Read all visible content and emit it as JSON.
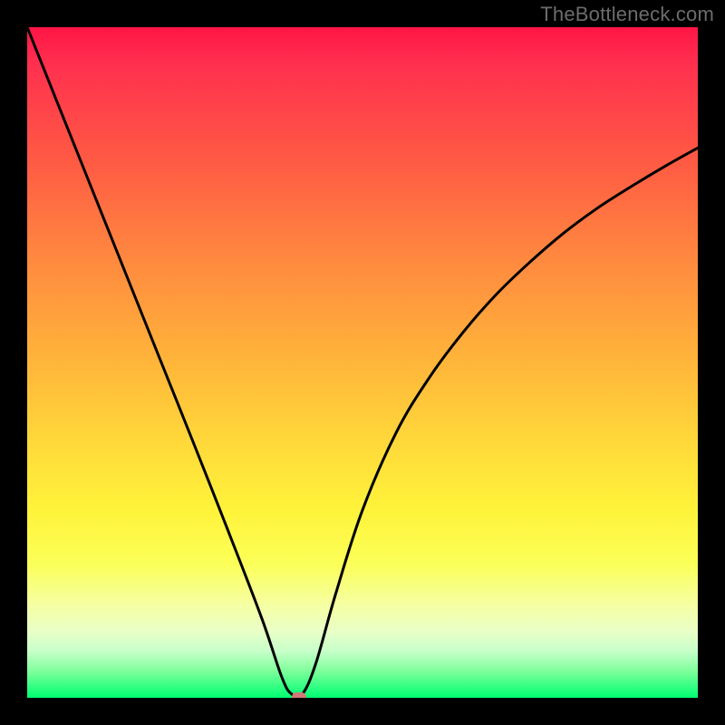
{
  "watermark": "TheBottleneck.com",
  "chart_data": {
    "type": "line",
    "title": "",
    "xlabel": "",
    "ylabel": "",
    "xlim": [
      0,
      1
    ],
    "ylim": [
      0,
      1
    ],
    "series": [
      {
        "name": "curve",
        "x": [
          0.0,
          0.05,
          0.1,
          0.15,
          0.2,
          0.25,
          0.3,
          0.35,
          0.38,
          0.395,
          0.41,
          0.43,
          0.46,
          0.5,
          0.55,
          0.6,
          0.65,
          0.7,
          0.75,
          0.8,
          0.85,
          0.9,
          0.95,
          1.0
        ],
        "y": [
          1.0,
          0.875,
          0.75,
          0.625,
          0.5,
          0.375,
          0.248,
          0.118,
          0.03,
          0.005,
          0.005,
          0.05,
          0.155,
          0.28,
          0.395,
          0.478,
          0.545,
          0.602,
          0.65,
          0.693,
          0.73,
          0.762,
          0.792,
          0.82
        ]
      }
    ],
    "marker": {
      "x": 0.405,
      "y": 0.002
    },
    "gradient_stops": [
      {
        "pos": 0.0,
        "color": "#ff1545"
      },
      {
        "pos": 0.2,
        "color": "#ff5a44"
      },
      {
        "pos": 0.5,
        "color": "#ffb53a"
      },
      {
        "pos": 0.72,
        "color": "#fff33a"
      },
      {
        "pos": 0.9,
        "color": "#eaffc7"
      },
      {
        "pos": 1.0,
        "color": "#00ff71"
      }
    ]
  }
}
